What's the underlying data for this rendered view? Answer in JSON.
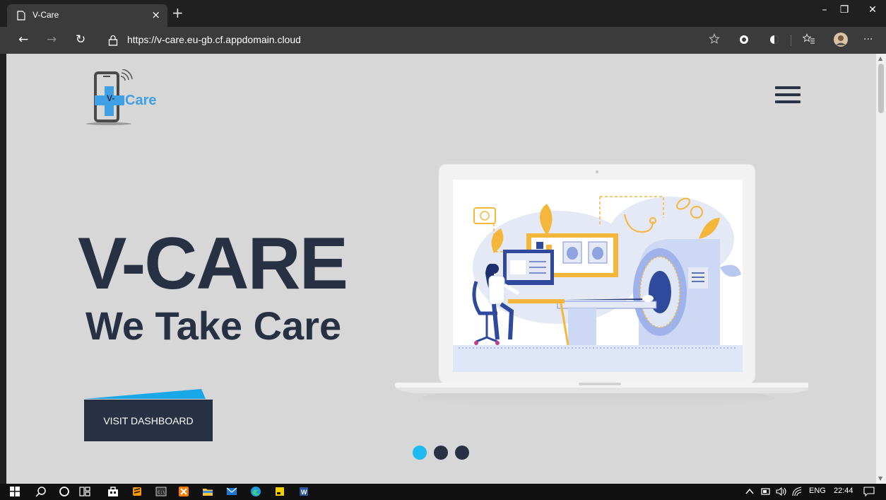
{
  "browser": {
    "tab_title": "V-Care",
    "tab_close": "×",
    "new_tab": "+",
    "url": "https://v-care.eu-gb.cf.appdomain.cloud",
    "window_controls": {
      "minimize": "–",
      "restore": "❐",
      "close": "✕"
    },
    "nav": {
      "back": "←",
      "forward": "→",
      "refresh": "↻"
    },
    "toolbar_icons": [
      "star-outline-icon",
      "extension-icon",
      "extension-icon",
      "favorites-icon",
      "profile-avatar",
      "more-icon"
    ],
    "more": "···"
  },
  "site": {
    "logo_text": "Care",
    "logo_mark": "V-",
    "hero_title": "V-CARE",
    "hero_subtitle": "We Take Care",
    "cta_label": "VISIT DASHBOARD",
    "carousel": {
      "count": 3,
      "active_index": 0
    },
    "colors": {
      "primary": "#283044",
      "accent": "#1aa7e8",
      "background": "#d7d7d7",
      "dot_active": "#1fbaf0",
      "dot": "#283044"
    }
  },
  "taskbar": {
    "tray_lang": "ENG",
    "tray_time": "22:44",
    "apps": [
      "windows-start-icon",
      "search-icon",
      "cortana-icon",
      "task-view-icon",
      "store-icon",
      "sublime-icon",
      "cmd-icon",
      "xampp-icon",
      "file-explorer-icon",
      "mail-icon",
      "edge-icon",
      "sticky-notes-icon",
      "word-icon"
    ]
  }
}
